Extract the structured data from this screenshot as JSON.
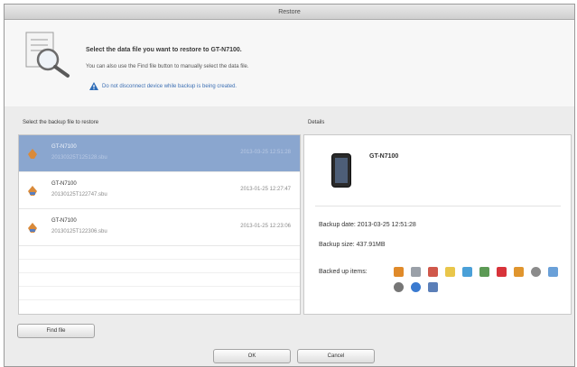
{
  "window": {
    "title": "Restore"
  },
  "header": {
    "line1": "Select the data file you want to restore to GT-N7100.",
    "line2": "You can also use the Find file button to manually select the data file.",
    "warning": "Do not disconnect device while backup is being created."
  },
  "list": {
    "label": "Select the backup file to restore",
    "rows": [
      {
        "name": "GT-N7100",
        "file": "20130325T125128.sbu",
        "date": "2013-03-25 12:51:28",
        "selected": true
      },
      {
        "name": "GT-N7100",
        "file": "20130125T122747.sbu",
        "date": "2013-01-25 12:27:47",
        "selected": false
      },
      {
        "name": "GT-N7100",
        "file": "20130125T122306.sbu",
        "date": "2013-01-25 12:23:06",
        "selected": false
      }
    ]
  },
  "details": {
    "label": "Details",
    "device_name": "GT-N7100",
    "backup_date": "Backup date: 2013-03-25 12:51:28",
    "backup_size": "Backup size: 437.91MB",
    "backed_up_label": "Backed up items:",
    "items": [
      {
        "icon": "contacts-icon",
        "color": "#e08a2a"
      },
      {
        "icon": "calendar-icon",
        "color": "#9aa0a8"
      },
      {
        "icon": "messages-icon",
        "color": "#d0584b"
      },
      {
        "icon": "email-icon",
        "color": "#e9c64a"
      },
      {
        "icon": "wifi-icon",
        "color": "#4aa0d8"
      },
      {
        "icon": "photos-icon",
        "color": "#5c9a55"
      },
      {
        "icon": "music-icon",
        "color": "#d8333a"
      },
      {
        "icon": "folder-icon",
        "color": "#e0952e"
      },
      {
        "icon": "settings-icon",
        "color": "#8b8b8b"
      },
      {
        "icon": "apps-icon",
        "color": "#6aa0d8"
      },
      {
        "icon": "gear-icon",
        "color": "#777777"
      },
      {
        "icon": "globe-icon",
        "color": "#3a7ad0"
      },
      {
        "icon": "device-icon",
        "color": "#5b7fb8"
      }
    ]
  },
  "buttons": {
    "find_file": "Find file",
    "ok": "OK",
    "cancel": "Cancel"
  },
  "colors": {
    "selection": "#8aa6cf",
    "warning_text": "#3c6fb3",
    "background": "#ececec"
  }
}
